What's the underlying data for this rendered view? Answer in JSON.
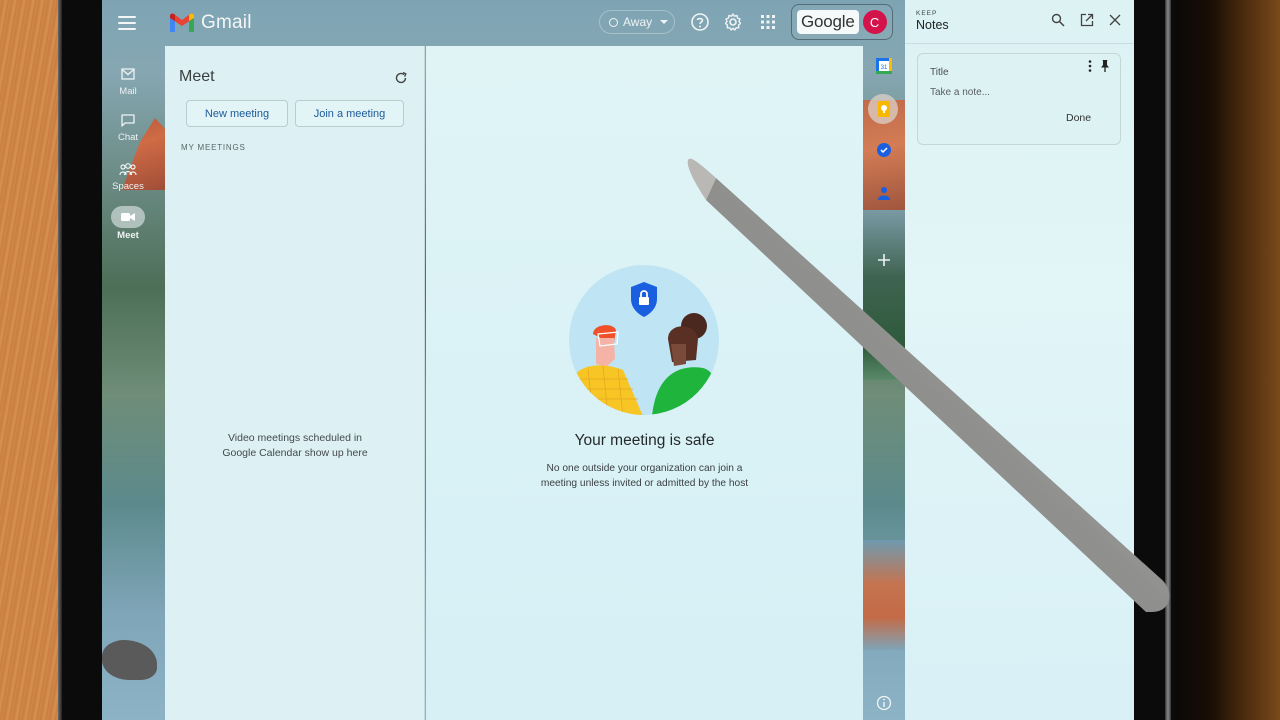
{
  "app": {
    "name": "Gmail",
    "menu_icon": "hamburger-menu-icon"
  },
  "topbar": {
    "status": {
      "label": "Away",
      "icon": "status-circle-icon",
      "dropdown_icon": "caret-down-icon"
    },
    "help_icon": "help-icon",
    "settings_icon": "gear-icon",
    "apps_icon": "apps-grid-icon",
    "account": {
      "org_label": "Google",
      "avatar_initial": "C",
      "avatar_color": "#d3134a"
    }
  },
  "rail": {
    "items": [
      {
        "label": "Mail",
        "icon": "mail-icon",
        "active": false
      },
      {
        "label": "Chat",
        "icon": "chat-icon",
        "active": false
      },
      {
        "label": "Spaces",
        "icon": "spaces-icon",
        "active": false
      },
      {
        "label": "Meet",
        "icon": "video-camera-icon",
        "active": true
      }
    ]
  },
  "meet": {
    "title": "Meet",
    "refresh_icon": "refresh-icon",
    "new_meeting_label": "New meeting",
    "join_meeting_label": "Join a meeting",
    "section_label": "MY MEETINGS",
    "empty_message_line1": "Video meetings scheduled in",
    "empty_message_line2": "Google Calendar show up here",
    "safe_title": "Your meeting is safe",
    "safe_description": "No one outside your organization can join a meeting unless invited or admitted by the host",
    "illustration": "meeting-safe-illustration"
  },
  "addons": {
    "items": [
      {
        "name": "calendar",
        "icon": "calendar-icon",
        "label": "31"
      },
      {
        "name": "keep",
        "icon": "keep-bulb-icon",
        "active": true
      },
      {
        "name": "tasks",
        "icon": "tasks-icon"
      },
      {
        "name": "contacts",
        "icon": "contacts-icon"
      },
      {
        "name": "add",
        "icon": "plus-icon"
      }
    ],
    "info_icon": "info-icon"
  },
  "keep": {
    "small_label": "KEEP",
    "title": "Notes",
    "search_icon": "search-icon",
    "open_new_icon": "open-in-new-icon",
    "close_icon": "close-icon",
    "note": {
      "title_placeholder": "Title",
      "body_placeholder": "Take a note...",
      "done_label": "Done",
      "more_icon": "more-vert-icon",
      "pin_icon": "pin-icon"
    }
  },
  "colors": {
    "brand_blue": "#1c5a9a",
    "avatar_red": "#d3134a",
    "panel_bg": "#ddf1f4"
  }
}
